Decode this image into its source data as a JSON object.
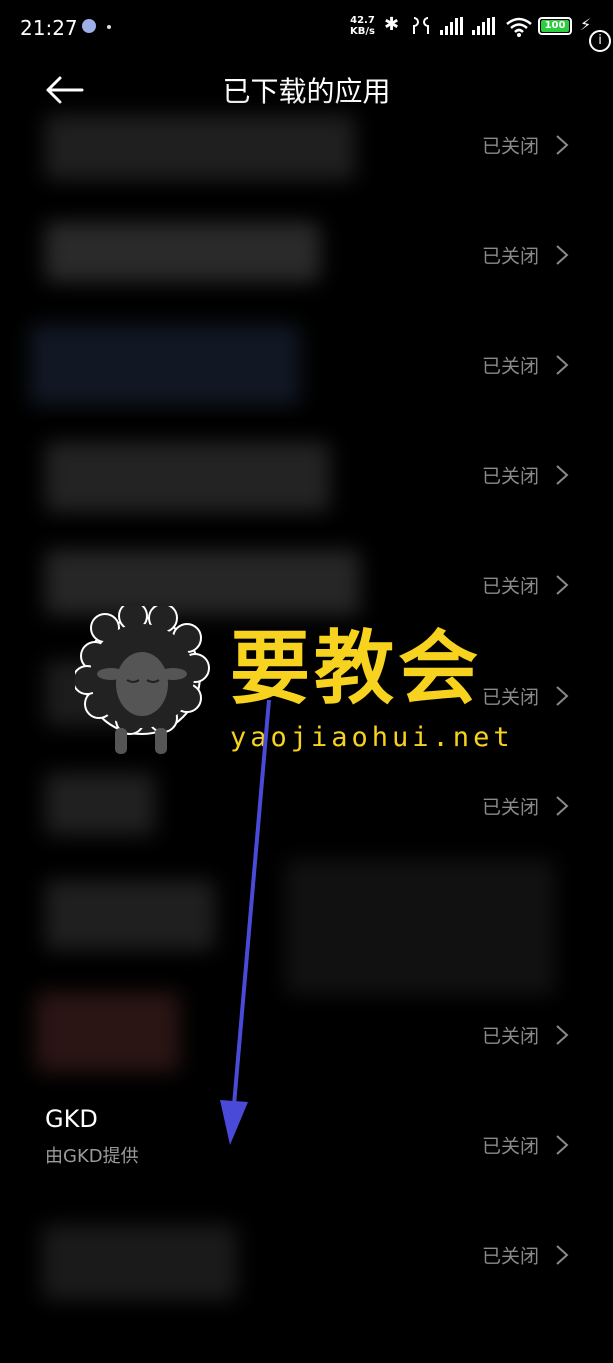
{
  "status_bar": {
    "time": "21:27",
    "net_speed_value": "42.7",
    "net_speed_unit": "KB/s",
    "battery": "100",
    "icons": [
      "bluetooth-icon",
      "earbuds-icon",
      "signal-icon",
      "signal-icon",
      "wifi-icon",
      "battery-icon",
      "charging-icon",
      "info-icon"
    ]
  },
  "header": {
    "title": "已下载的应用"
  },
  "apps": [
    {
      "name": "",
      "status": "已关闭"
    },
    {
      "name": "",
      "status": "已关闭"
    },
    {
      "name": "",
      "status": "已关闭"
    },
    {
      "name": "",
      "status": "已关闭"
    },
    {
      "name": "",
      "status": "已关闭"
    },
    {
      "name": "",
      "status": "已关闭"
    },
    {
      "name": "",
      "status": "已关闭"
    },
    {
      "name": "",
      "status": ""
    },
    {
      "name": "",
      "status": "已关闭"
    },
    {
      "name": "GKD",
      "subtitle": "由GKD提供",
      "status": "已关闭"
    },
    {
      "name": "",
      "status": "已关闭"
    }
  ],
  "watermark": {
    "text": "要教会",
    "url": "yaojiaohui.net"
  },
  "colors": {
    "status_gray": "#8a8a8a",
    "watermark_yellow": "#f7d21e",
    "arrow_blue": "#4a4ad8"
  }
}
